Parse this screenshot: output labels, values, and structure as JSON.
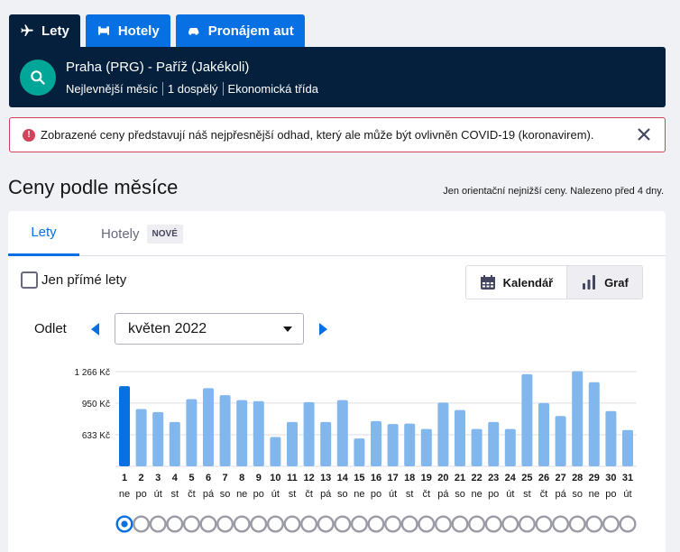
{
  "top_tabs": [
    {
      "label": "Lety",
      "icon": "plane-icon",
      "active": true
    },
    {
      "label": "Hotely",
      "icon": "bed-icon",
      "active": false
    },
    {
      "label": "Pronájem aut",
      "icon": "car-icon",
      "active": false
    }
  ],
  "search": {
    "route": "Praha (PRG) - Paříž (Jakékoli)",
    "meta": [
      "Nejlevnější měsíc",
      "1 dospělý",
      "Ekonomická třída"
    ]
  },
  "alert": {
    "icon_text": "!",
    "text": "Zobrazené ceny představují náš nejpřesnější odhad, který ale může být ovlivněn COVID-19 (koronavirem)."
  },
  "heading": {
    "title": "Ceny podle měsíce",
    "note": "Jen orientační nejnižší ceny. Nalezeno před 4 dny."
  },
  "card_tabs": {
    "flights": "Lety",
    "hotels": "Hotely",
    "hotels_badge": "NOVÉ"
  },
  "direct_only": {
    "label": "Jen přímé lety",
    "checked": false
  },
  "view_toggle": {
    "calendar": "Kalendář",
    "graph": "Graf",
    "selected": "graph"
  },
  "departure": {
    "label": "Odlet",
    "month": "květen 2022"
  },
  "colors": {
    "navy": "#05203c",
    "blue": "#0770e3",
    "teal": "#00a698",
    "alert": "#d1435b",
    "bar_selected": "#0770e3",
    "bar": "#82b7ee",
    "dot_border": "#9b9ba5"
  },
  "chart_data": {
    "type": "bar",
    "categories": [
      "1",
      "2",
      "3",
      "4",
      "5",
      "6",
      "7",
      "8",
      "9",
      "10",
      "11",
      "12",
      "13",
      "14",
      "15",
      "16",
      "17",
      "18",
      "19",
      "20",
      "21",
      "22",
      "23",
      "24",
      "25",
      "26",
      "27",
      "28",
      "29",
      "30",
      "31"
    ],
    "weekdays": [
      "ne",
      "po",
      "út",
      "st",
      "čt",
      "pá",
      "so",
      "ne",
      "po",
      "út",
      "st",
      "čt",
      "pá",
      "so",
      "ne",
      "po",
      "út",
      "st",
      "čt",
      "pá",
      "so",
      "ne",
      "po",
      "út",
      "st",
      "čt",
      "pá",
      "so",
      "ne",
      "po",
      "út"
    ],
    "values": [
      1120,
      890,
      860,
      760,
      990,
      1100,
      1030,
      980,
      970,
      610,
      760,
      960,
      760,
      980,
      595,
      770,
      740,
      745,
      690,
      955,
      880,
      690,
      760,
      690,
      1240,
      950,
      820,
      1270,
      1160,
      870,
      680
    ],
    "ytick_labels": [
      "1 266 Kč",
      "950 Kč",
      "633 Kč"
    ],
    "ytick_values": [
      1266,
      950,
      633
    ],
    "ylim": [
      316,
      1266
    ],
    "selected_index": 0,
    "grid": true
  }
}
